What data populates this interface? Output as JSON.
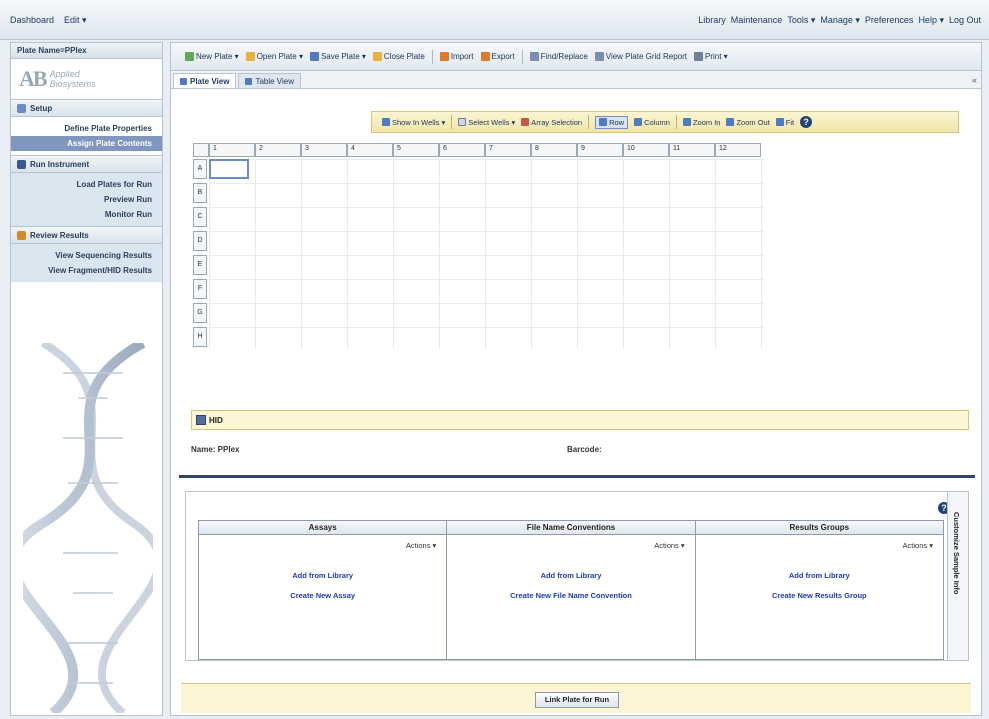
{
  "topbar": {
    "left": [
      "Dashboard",
      "Edit ▾"
    ],
    "right": [
      "Library",
      "Maintenance",
      "Tools ▾",
      "Manage ▾",
      "Preferences",
      "Help ▾",
      "Log Out"
    ]
  },
  "sidebar": {
    "title": "Plate Name=PPlex",
    "logo_lines": [
      "Applied",
      "Biosystems"
    ],
    "sections": [
      {
        "label": "Setup",
        "links": [
          "Define Plate Properties",
          "Assign Plate Contents"
        ],
        "active": 1
      },
      {
        "label": "Run Instrument",
        "links": [
          "Load Plates for Run",
          "Preview Run",
          "Monitor Run"
        ]
      },
      {
        "label": "Review Results",
        "links": [
          "View Sequencing Results",
          "View Fragment/HID Results"
        ]
      }
    ]
  },
  "toolbar": {
    "items": [
      "New Plate ▾",
      "Open Plate ▾",
      "Save Plate ▾",
      "Close Plate",
      "Import",
      "Export",
      "Find/Replace",
      "View Plate Grid Report",
      "Print ▾"
    ]
  },
  "tabs": [
    "Plate View",
    "Table View"
  ],
  "viewbar": {
    "items": [
      "Show In Wells ▾",
      "Select Wells ▾",
      "Array Selection",
      "Row",
      "Column",
      "Zoom In",
      "Zoom Out",
      "Fit"
    ],
    "pressed": 3
  },
  "plate": {
    "columns": [
      "1",
      "2",
      "3",
      "4",
      "5",
      "6",
      "7",
      "8",
      "9",
      "10",
      "11",
      "12"
    ],
    "rows": [
      "A",
      "B",
      "C",
      "D",
      "E",
      "F",
      "G",
      "H"
    ]
  },
  "id_bar": {
    "label": "HID"
  },
  "fields": {
    "name": "Name: PPlex",
    "barcode": "Barcode:"
  },
  "groups": {
    "columns": [
      {
        "header": "Assays",
        "actions": "Actions ▾",
        "links": [
          "Add from Library",
          "Create New Assay"
        ]
      },
      {
        "header": "File Name Conventions",
        "actions": "Actions ▾",
        "links": [
          "Add from Library",
          "Create New File Name Convention"
        ]
      },
      {
        "header": "Results Groups",
        "actions": "Actions ▾",
        "links": [
          "Add from Library",
          "Create New Results Group"
        ]
      }
    ]
  },
  "side_tab": "Customize Sample Info",
  "footer": {
    "button": "Link Plate for Run"
  }
}
